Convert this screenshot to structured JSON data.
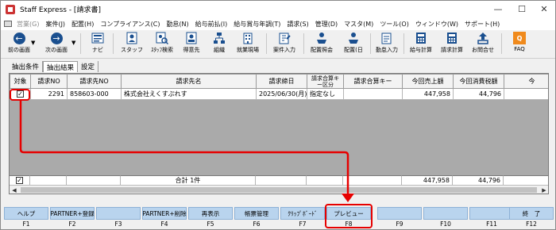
{
  "window": {
    "title": "Staff Express - [請求書]",
    "minimize": "—",
    "maximize": "☐",
    "close": "✕"
  },
  "menu": [
    {
      "label": "営業(G)",
      "dim": true
    },
    {
      "label": "案件(J)",
      "dim": false
    },
    {
      "label": "配置(H)",
      "dim": false
    },
    {
      "label": "コンプライアンス(C)",
      "dim": false
    },
    {
      "label": "勤怠(N)",
      "dim": false
    },
    {
      "label": "給与前払(I)",
      "dim": false
    },
    {
      "label": "給与賞与年調(T)",
      "dim": false
    },
    {
      "label": "請求(S)",
      "dim": false
    },
    {
      "label": "管理(D)",
      "dim": false
    },
    {
      "label": "マスタ(M)",
      "dim": false
    },
    {
      "label": "ツール(O)",
      "dim": false
    },
    {
      "label": "ウィンドウ(W)",
      "dim": false
    },
    {
      "label": "サポート(H)",
      "dim": false
    }
  ],
  "toolbar": {
    "back": "前の画面",
    "next": "次の画面",
    "navi": "ナビ",
    "staff": "スタッフ",
    "staff_search": "ｽﾀｯﾌ検索",
    "client": "得意先",
    "org": "組織",
    "site": "就業現場",
    "job_entry": "案件入力",
    "assign_inquiry": "配置照会",
    "assign_day": "配置(日",
    "attendance_entry": "勤怠入力",
    "salary_calc": "給与計算",
    "billing_calc": "請求計算",
    "contact": "お問合せ",
    "faq": "FAQ"
  },
  "tabs": [
    "抽出条件",
    "抽出結果",
    "設定"
  ],
  "grid": {
    "headers": [
      "対象",
      "請求NO",
      "請求先NO",
      "請求先名",
      "請求締日",
      "請求合算キー区分",
      "請求合算キー",
      "今回売上額",
      "今回消費税額",
      "今"
    ],
    "rows": [
      {
        "checked": "✓",
        "no": "2291",
        "client_no": "858603-000",
        "name": "株式会社えくすぷれす",
        "close_date": "2025/06/30(月)",
        "key_type": "指定なし",
        "key": "",
        "sales": "447,958",
        "tax": "44,796"
      }
    ],
    "summary": {
      "checked": "✓",
      "label": "合計 1件",
      "sales": "447,958",
      "tax": "44,796"
    }
  },
  "fkeys": [
    {
      "label": "ヘルプ",
      "num": "F1"
    },
    {
      "label": "PARTNER+登録",
      "num": "F2"
    },
    {
      "label": "",
      "num": "F3"
    },
    {
      "label": "PARTNER+削除",
      "num": "F4"
    },
    {
      "label": "再表示",
      "num": "F5"
    },
    {
      "label": "帳票管理",
      "num": "F6"
    },
    {
      "label": "ｸﾘｯﾌﾟﾎﾞｰﾄﾞ",
      "num": "F7"
    },
    {
      "label": "プレビュー",
      "num": "F8"
    },
    {
      "label": "",
      "num": "F9"
    },
    {
      "label": "",
      "num": "F10"
    },
    {
      "label": "",
      "num": "F11"
    },
    {
      "label": "終　了",
      "num": "F12"
    }
  ],
  "annotation_color": "#e60000"
}
